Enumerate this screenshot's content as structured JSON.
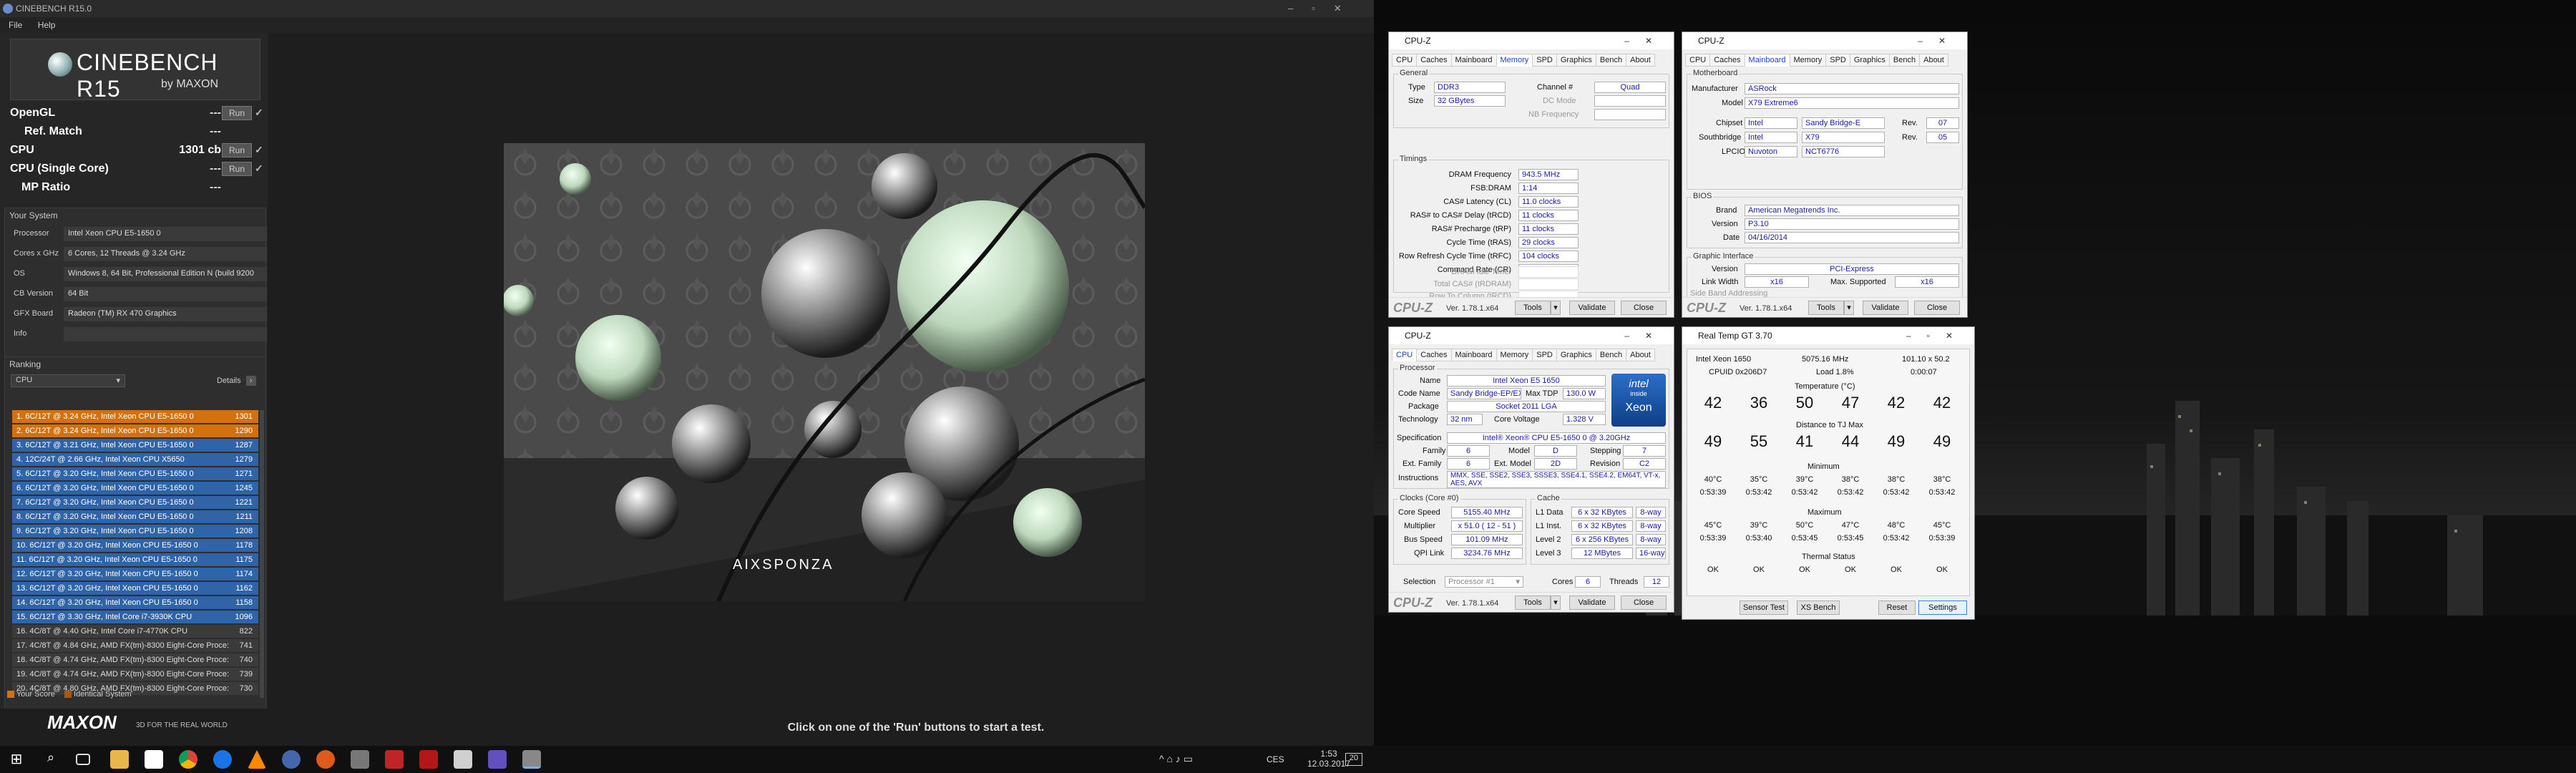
{
  "cinebench": {
    "title": "CINEBENCH R15.0",
    "menu": [
      "File",
      "Help"
    ],
    "logo_title": "CINEBENCH R15",
    "logo_sub": "by MAXON",
    "tests": [
      {
        "label": "OpenGL",
        "value": "---",
        "run": "Run",
        "check": "✓"
      },
      {
        "label": "Ref. Match",
        "value": "---",
        "run": "",
        "check": ""
      },
      {
        "label": "CPU",
        "value": "1301 cb",
        "run": "Run",
        "check": "✓"
      },
      {
        "label": "CPU (Single Core)",
        "value": "---",
        "run": "Run",
        "check": "✓"
      },
      {
        "label": "MP Ratio",
        "value": "---",
        "run": "",
        "check": ""
      }
    ],
    "system_header": "Your System",
    "system": [
      {
        "key": "Processor",
        "value": "Intel Xeon CPU E5-1650 0"
      },
      {
        "key": "Cores x GHz",
        "value": "6 Cores, 12 Threads @ 3.24 GHz"
      },
      {
        "key": "OS",
        "value": "Windows 8, 64 Bit, Professional Edition N (build 9200"
      },
      {
        "key": "CB Version",
        "value": "64 Bit"
      },
      {
        "key": "GFX Board",
        "value": "Radeon (TM) RX 470 Graphics"
      },
      {
        "key": "Info",
        "value": ""
      }
    ],
    "ranking_header": "Ranking",
    "ranking_select": "CPU",
    "details_label": "Details",
    "ranking": [
      {
        "text": "1. 6C/12T @ 3.24 GHz, Intel Xeon CPU E5-1650 0",
        "score": "1301",
        "kind": "mine"
      },
      {
        "text": "2. 6C/12T @ 3.24 GHz, Intel Xeon CPU E5-1650 0",
        "score": "1290",
        "kind": "mine"
      },
      {
        "text": "3. 6C/12T @ 3.21 GHz, Intel Xeon CPU E5-1650 0",
        "score": "1287",
        "kind": "blue"
      },
      {
        "text": "4. 12C/24T @ 2.66 GHz, Intel Xeon CPU X5650",
        "score": "1279",
        "kind": "blue"
      },
      {
        "text": "5. 6C/12T @ 3.20 GHz, Intel Xeon CPU E5-1650 0",
        "score": "1271",
        "kind": "blue"
      },
      {
        "text": "6. 6C/12T @ 3.20 GHz, Intel Xeon CPU E5-1650 0",
        "score": "1245",
        "kind": "blue"
      },
      {
        "text": "7. 6C/12T @ 3.20 GHz, Intel Xeon CPU E5-1650 0",
        "score": "1221",
        "kind": "blue"
      },
      {
        "text": "8. 6C/12T @ 3.20 GHz, Intel Xeon CPU E5-1650 0",
        "score": "1211",
        "kind": "blue"
      },
      {
        "text": "9. 6C/12T @ 3.20 GHz, Intel Xeon CPU E5-1650 0",
        "score": "1208",
        "kind": "blue"
      },
      {
        "text": "10. 6C/12T @ 3.20 GHz, Intel Xeon CPU E5-1650 0",
        "score": "1178",
        "kind": "blue"
      },
      {
        "text": "11. 6C/12T @ 3.20 GHz, Intel Xeon CPU E5-1650 0",
        "score": "1175",
        "kind": "blue"
      },
      {
        "text": "12. 6C/12T @ 3.20 GHz, Intel Xeon CPU E5-1650 0",
        "score": "1174",
        "kind": "blue"
      },
      {
        "text": "13. 6C/12T @ 3.20 GHz, Intel Xeon CPU E5-1650 0",
        "score": "1162",
        "kind": "blue"
      },
      {
        "text": "14. 6C/12T @ 3.20 GHz, Intel Xeon CPU E5-1650 0",
        "score": "1158",
        "kind": "blue"
      },
      {
        "text": "15. 6C/12T @ 3.30 GHz, Intel Core i7-3930K CPU",
        "score": "1096",
        "kind": "blue"
      },
      {
        "text": "16. 4C/8T @ 4.40 GHz, Intel Core i7-4770K CPU",
        "score": "822",
        "kind": "dark"
      },
      {
        "text": "17. 4C/8T @ 4.84 GHz, AMD FX(tm)-8300 Eight-Core Proce:",
        "score": "741",
        "kind": "dark"
      },
      {
        "text": "18. 4C/8T @ 4.74 GHz, AMD FX(tm)-8300 Eight-Core Proce:",
        "score": "740",
        "kind": "dark"
      },
      {
        "text": "19. 4C/8T @ 4.74 GHz, AMD FX(tm)-8300 Eight-Core Proce:",
        "score": "739",
        "kind": "dark"
      },
      {
        "text": "20. 4C/8T @ 4.80 GHz, AMD FX(tm)-8300 Eight-Core Proce:",
        "score": "730",
        "kind": "dark"
      }
    ],
    "legend_your": "Your Score",
    "legend_identical": "Identical System",
    "maxon": "MAXON",
    "maxon_tag": "3D FOR THE REAL WORLD",
    "render_credit": "AIXSPONZA",
    "status": "Click on one of the 'Run' buttons to start a test."
  },
  "cpuz_memory": {
    "title": "CPU-Z",
    "tabs": [
      "CPU",
      "Caches",
      "Mainboard",
      "Memory",
      "SPD",
      "Graphics",
      "Bench",
      "About"
    ],
    "active_tab": "Memory",
    "general_legend": "General",
    "type_label": "Type",
    "type": "DDR3",
    "size_label": "Size",
    "size": "32 GBytes",
    "channel_label": "Channel #",
    "channel": "Quad",
    "dc_label": "DC Mode",
    "nb_label": "NB Frequency",
    "timings_legend": "Timings",
    "timings": [
      {
        "k": "DRAM Frequency",
        "v": "943.5 MHz"
      },
      {
        "k": "FSB:DRAM",
        "v": "1:14"
      },
      {
        "k": "CAS# Latency (CL)",
        "v": "11.0 clocks"
      },
      {
        "k": "RAS# to CAS# Delay (tRCD)",
        "v": "11 clocks"
      },
      {
        "k": "RAS# Precharge (tRP)",
        "v": "11 clocks"
      },
      {
        "k": "Cycle Time (tRAS)",
        "v": "29 clocks"
      },
      {
        "k": "Row Refresh Cycle Time (tRFC)",
        "v": "104 clocks"
      },
      {
        "k": "Command Rate (CR)",
        "v": "2T"
      }
    ],
    "timings_dim": [
      "DRAM Idle Timer",
      "Total CAS# (tRDRAM)",
      "Row To Column (tRCD)"
    ],
    "brand": "CPU-Z",
    "version": "Ver. 1.78.1.x64",
    "tools": "Tools",
    "validate": "Validate",
    "close": "Close"
  },
  "cpuz_mainboard": {
    "title": "CPU-Z",
    "tabs": [
      "CPU",
      "Caches",
      "Mainboard",
      "Memory",
      "SPD",
      "Graphics",
      "Bench",
      "About"
    ],
    "active_tab": "Mainboard",
    "mb_legend": "Motherboard",
    "manufacturer_label": "Manufacturer",
    "manufacturer": "ASRock",
    "model_label": "Model",
    "model": "X79 Extreme6",
    "chipset_label": "Chipset",
    "chipset_v": "Intel",
    "chipset_n": "Sandy Bridge-E",
    "chipset_rev_label": "Rev.",
    "chipset_rev": "07",
    "south_label": "Southbridge",
    "south_v": "Intel",
    "south_n": "X79",
    "south_rev_label": "Rev.",
    "south_rev": "05",
    "lpcio_label": "LPCIO",
    "lpcio_v": "Nuvoton",
    "lpcio_n": "NCT6776",
    "bios_legend": "BIOS",
    "bios_brand_label": "Brand",
    "bios_brand": "American Megatrends Inc.",
    "bios_version_label": "Version",
    "bios_version": "P3.10",
    "bios_date_label": "Date",
    "bios_date": "04/16/2014",
    "gi_legend": "Graphic Interface",
    "gi_version_label": "Version",
    "gi_version": "PCI-Express",
    "gi_lw_label": "Link Width",
    "gi_lw": "x16",
    "gi_max_label": "Max. Supported",
    "gi_max": "x16",
    "gi_side": "Side Band Addressing",
    "brand": "CPU-Z",
    "version": "Ver. 1.78.1.x64",
    "tools": "Tools",
    "validate": "Validate",
    "close": "Close"
  },
  "cpuz_cpu": {
    "title": "CPU-Z",
    "tabs": [
      "CPU",
      "Caches",
      "Mainboard",
      "Memory",
      "SPD",
      "Graphics",
      "Bench",
      "About"
    ],
    "active_tab": "CPU",
    "proc_legend": "Processor",
    "name_label": "Name",
    "name": "Intel Xeon E5 1650",
    "codename_label": "Code Name",
    "codename": "Sandy Bridge-EP/EX",
    "tdp_label": "Max TDP",
    "tdp": "130.0 W",
    "package_label": "Package",
    "package": "Socket 2011 LGA",
    "tech_label": "Technology",
    "tech": "32 nm",
    "vcore_label": "Core Voltage",
    "vcore": "1.328 V",
    "spec_label": "Specification",
    "spec": "Intel® Xeon® CPU E5-1650 0 @ 3.20GHz",
    "family_label": "Family",
    "family": "6",
    "model_label": "Model",
    "model": "D",
    "stepping_label": "Stepping",
    "stepping": "7",
    "extfam_label": "Ext. Family",
    "extfam": "6",
    "extmodel_label": "Ext. Model",
    "extmodel": "2D",
    "revision_label": "Revision",
    "revision": "C2",
    "instr_label": "Instructions",
    "instr": "MMX, SSE, SSE2, SSE3, SSSE3, SSE4.1, SSE4.2, EM64T, VT-x, AES, AVX",
    "intel_logo_top": "intel",
    "intel_logo_mid": "inside",
    "intel_logo_bottom": "Xeon",
    "clocks_legend": "Clocks (Core #0)",
    "corespeed_label": "Core Speed",
    "corespeed": "5155.40 MHz",
    "mult_label": "Multiplier",
    "mult": "x 51.0 ( 12 - 51 )",
    "bus_label": "Bus Speed",
    "bus": "101.09 MHz",
    "qpi_label": "QPI Link",
    "qpi": "3234.76 MHz",
    "cache_legend": "Cache",
    "caches": [
      {
        "k": "L1 Data",
        "v": "6 x 32 KBytes",
        "w": "8-way"
      },
      {
        "k": "L1 Inst.",
        "v": "6 x 32 KBytes",
        "w": "8-way"
      },
      {
        "k": "Level 2",
        "v": "6 x 256 KBytes",
        "w": "8-way"
      },
      {
        "k": "Level 3",
        "v": "12 MBytes",
        "w": "16-way"
      }
    ],
    "selection_label": "Selection",
    "selection": "Processor #1",
    "cores_label": "Cores",
    "cores": "6",
    "threads_label": "Threads",
    "threads": "12",
    "brand": "CPU-Z",
    "version": "Ver. 1.78.1.x64",
    "tools": "Tools",
    "validate": "Validate",
    "close": "Close"
  },
  "realtemp": {
    "title": "Real Temp GT 3.70",
    "cpu": "Intel Xeon 1650",
    "freq": "5075.16 MHz",
    "vid": "101.10 x 50.2",
    "cpuid": "CPUID 0x206D7",
    "load": "Load 1.8%",
    "time": "0:00:07",
    "temp_header": "Temperature (°C)",
    "temps": [
      "42",
      "36",
      "50",
      "47",
      "42",
      "42"
    ],
    "tjmax_header": "Distance to TJ Max",
    "dist": [
      "49",
      "55",
      "41",
      "44",
      "49",
      "49"
    ],
    "min_header": "Minimum",
    "min_temps": [
      "40°C",
      "35°C",
      "39°C",
      "38°C",
      "38°C",
      "38°C"
    ],
    "min_times": [
      "0:53:39",
      "0:53:42",
      "0:53:42",
      "0:53:42",
      "0:53:42",
      "0:53:42"
    ],
    "max_header": "Maximum",
    "max_temps": [
      "45°C",
      "39°C",
      "50°C",
      "47°C",
      "48°C",
      "45°C"
    ],
    "max_times": [
      "0:53:39",
      "0:53:40",
      "0:53:45",
      "0:53:45",
      "0:53:42",
      "0:53:39"
    ],
    "thermal_header": "Thermal Status",
    "status": [
      "OK",
      "OK",
      "OK",
      "OK",
      "OK",
      "OK"
    ],
    "buttons": [
      "Sensor Test",
      "XS Bench",
      "Reset",
      "Settings"
    ]
  },
  "taskbar": {
    "lang": "CES",
    "time": "1:53",
    "date": "12.03.2017",
    "notif": "20"
  },
  "colors": {
    "accent_orange": "#d2720e",
    "accent_blue": "#2f64a8",
    "cpuz_tab_blue": "#1f3fbf"
  }
}
